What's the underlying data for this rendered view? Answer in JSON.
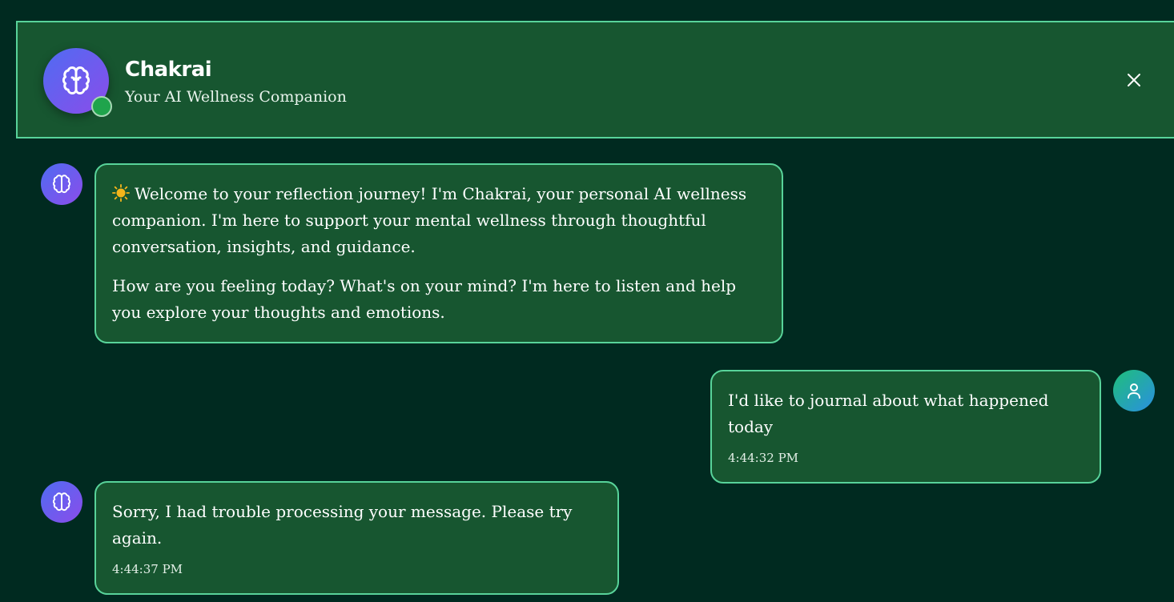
{
  "header": {
    "title": "Chakrai",
    "subtitle": "Your AI Wellness Companion",
    "logo_icon": "brain-icon",
    "status": "online",
    "close_icon": "close-icon"
  },
  "messages": [
    {
      "role": "assistant",
      "avatar_icon": "brain-icon",
      "emoji": "sun-icon",
      "paragraphs": [
        "Welcome to your reflection journey! I'm Chakrai, your personal AI wellness companion. I'm here to support your mental wellness through thoughtful conversation, insights, and guidance.",
        "How are you feeling today? What's on your mind? I'm here to listen and help you explore your thoughts and emotions."
      ]
    },
    {
      "role": "user",
      "avatar_icon": "user-icon",
      "text": "I'd like to journal about what happened today",
      "time": "4:44:32 PM"
    },
    {
      "role": "assistant",
      "avatar_icon": "brain-icon",
      "text": "Sorry, I had trouble processing your message. Please try again.",
      "time": "4:44:37 PM"
    }
  ],
  "colors": {
    "background": "#002a20",
    "panel": "#175630",
    "border": "#58d39a",
    "bot_gradient_start": "#4f6cf2",
    "bot_gradient_end": "#8b4cea",
    "user_gradient_start": "#1fbf7a",
    "user_gradient_end": "#2a8fe0",
    "online": "#1fa44c"
  }
}
